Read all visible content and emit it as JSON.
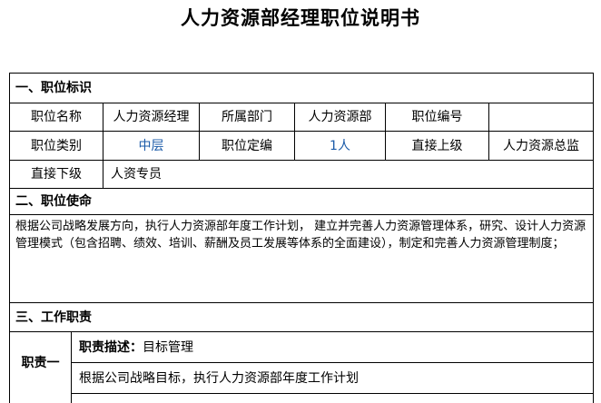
{
  "document": {
    "title": "人力资源部经理职位说明书"
  },
  "section1": {
    "heading": "一、职位标识",
    "rows": [
      [
        "职位名称",
        "人力资源经理",
        "所属部门",
        "人力资源部",
        "职位编号",
        ""
      ],
      [
        "职位类别",
        "中层",
        "职位定编",
        "1人",
        "直接上级",
        "人力资源总监"
      ]
    ],
    "subordinate_label": "直接下级",
    "subordinate_value": "人资专员"
  },
  "section2": {
    "heading": "二、职位使命",
    "text": "根据公司战略发展方向，执行人力资源部年度工作计划，   建立并完善人力资源管理体系，研究、设计人力资源管理模式（包含招聘、绩效、培训、薪酬及员工发展等体系的全面建设），制定和完善人力资源管理制度；"
  },
  "section3": {
    "heading": "三、工作职责",
    "duty1": {
      "label": "职责一",
      "desc_label": "职责描述：",
      "desc_value": "目标管理",
      "detail": "根据公司战略目标，执行人力资源部年度工作计划"
    }
  }
}
